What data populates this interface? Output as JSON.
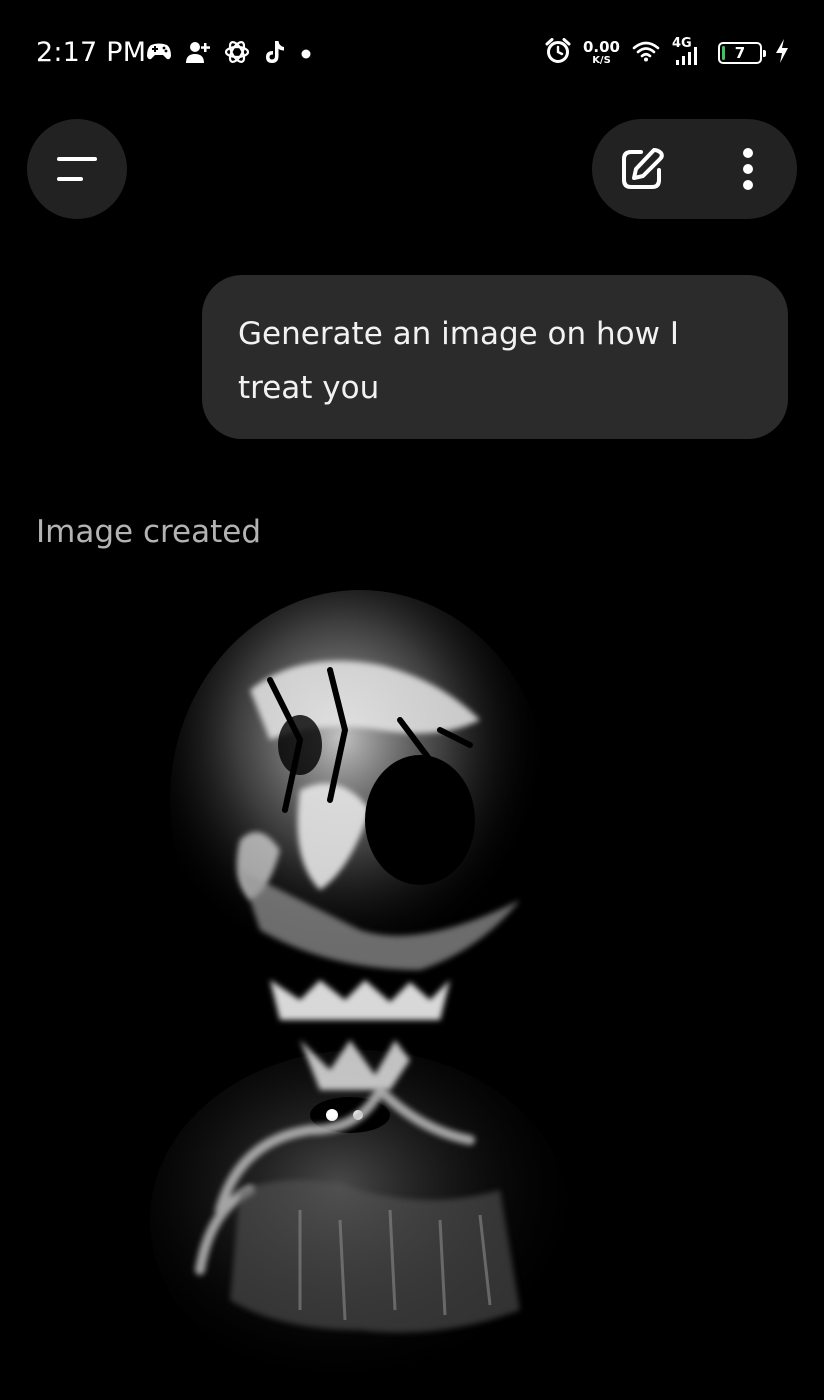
{
  "status_bar": {
    "time": "2:17 PM",
    "left_icons": [
      "gamepad-icon",
      "add-person-icon",
      "chatgpt-logo-icon",
      "tiktok-icon",
      "dot-icon"
    ],
    "alarm_icon": "alarm-icon",
    "network_speed_value": "0.00",
    "network_speed_unit": "K/S",
    "wifi_icon": "wifi-icon",
    "cellular_label": "4G",
    "battery_level": "7",
    "battery_fraction": 0.07,
    "charging_icon": "bolt-icon"
  },
  "toolbar": {
    "menu_icon": "menu-icon",
    "new_chat_icon": "edit-icon",
    "more_icon": "more-vertical-icon"
  },
  "chat": {
    "user_message": "Generate an image on how I treat you",
    "assistant_label": "Image created"
  },
  "colors": {
    "background": "#000000",
    "surface": "#222222",
    "bubble": "#2b2b2b",
    "label_gray": "#b3b3b3",
    "battery_green": "#3ec45a"
  }
}
